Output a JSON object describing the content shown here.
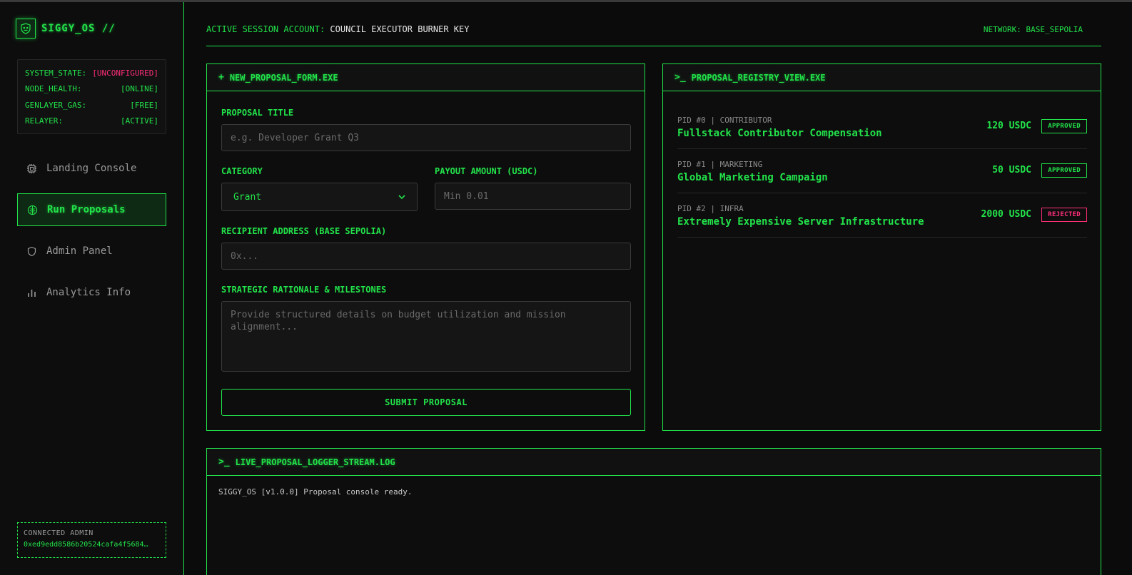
{
  "app": {
    "title": "SIGGY_OS //"
  },
  "system_status": [
    {
      "key": "SYSTEM_STATE:",
      "value": "[UNCONFIGURED]",
      "color": "#ff2e7a"
    },
    {
      "key": "NODE_HEALTH:",
      "value": "[ONLINE]",
      "color": "#22e34a"
    },
    {
      "key": "GENLAYER_GAS:",
      "value": "[FREE]",
      "color": "#22e34a"
    },
    {
      "key": "RELAYER:",
      "value": "[ACTIVE]",
      "color": "#22e34a"
    }
  ],
  "nav": [
    {
      "label": "Landing Console",
      "icon": "cpu-icon",
      "active": false
    },
    {
      "label": "Run Proposals",
      "icon": "brain-icon",
      "active": true
    },
    {
      "label": "Admin Panel",
      "icon": "shield-icon",
      "active": false
    },
    {
      "label": "Analytics Info",
      "icon": "bar-chart-icon",
      "active": false
    }
  ],
  "admin": {
    "label": "CONNECTED ADMIN",
    "address": "0xed9edd8586b20524cafa4f5684…"
  },
  "header": {
    "session_label": "ACTIVE SESSION ACCOUNT:",
    "session_value": "COUNCIL EXECUTOR BURNER KEY",
    "network": "NETWORK: BASE_SEPOLIA"
  },
  "form": {
    "title": "NEW_PROPOSAL_FORM.EXE",
    "proposal_title_label": "PROPOSAL TITLE",
    "proposal_title_placeholder": "e.g. Developer Grant Q3",
    "category_label": "CATEGORY",
    "category_value": "Grant",
    "payout_label": "PAYOUT AMOUNT (USDC)",
    "payout_placeholder": "Min 0.01",
    "recipient_label": "RECIPIENT ADDRESS (BASE SEPOLIA)",
    "recipient_placeholder": "0x...",
    "rationale_label": "STRATEGIC RATIONALE & MILESTONES",
    "rationale_placeholder": "Provide structured details on budget utilization and mission alignment...",
    "submit_label": "SUBMIT PROPOSAL"
  },
  "registry": {
    "title": "PROPOSAL_REGISTRY_VIEW.EXE",
    "items": [
      {
        "meta": "PID #0 | CONTRIBUTOR",
        "name": "Fullstack Contributor Compensation",
        "amount": "120 USDC",
        "status": "APPROVED"
      },
      {
        "meta": "PID #1 | MARKETING",
        "name": "Global Marketing Campaign",
        "amount": "50 USDC",
        "status": "APPROVED"
      },
      {
        "meta": "PID #2 | INFRA",
        "name": "Extremely Expensive Server Infrastructure",
        "amount": "2000 USDC",
        "status": "REJECTED"
      }
    ]
  },
  "logger": {
    "title": "LIVE_PROPOSAL_LOGGER_STREAM.LOG",
    "lines": [
      "SIGGY_OS [v1.0.0] Proposal console ready."
    ]
  },
  "colors": {
    "accent": "#22e34a",
    "danger": "#ff2e7a",
    "bg": "#0b0b0b"
  }
}
